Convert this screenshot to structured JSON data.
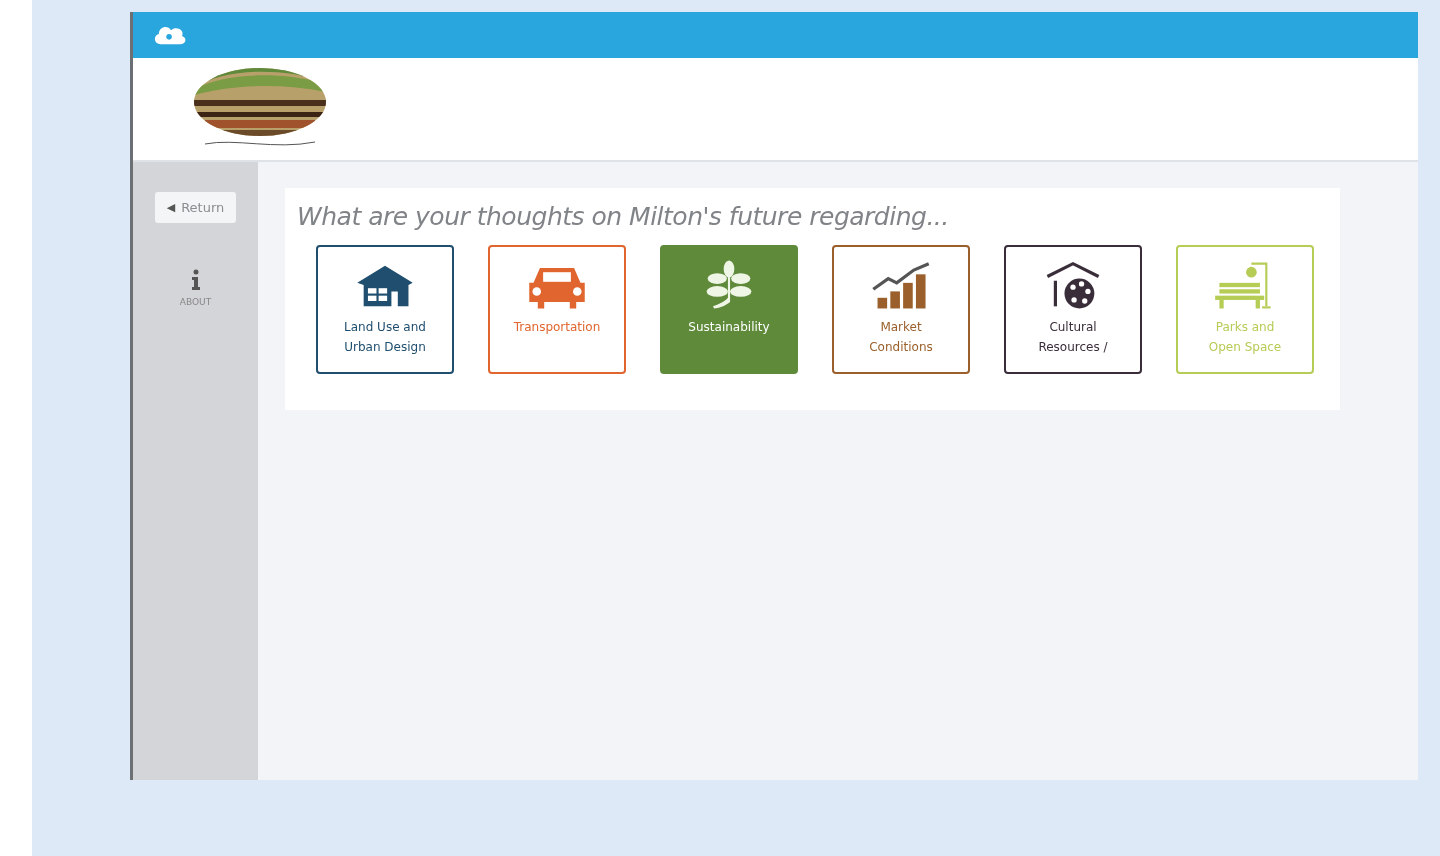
{
  "sidebar": {
    "return_button": {
      "arrow": "◀",
      "label": "Return"
    },
    "about": {
      "label": "ABOUT"
    }
  },
  "question": "What are your thoughts on Milton's future regarding...",
  "topics": [
    {
      "label": "Land Use and Urban Design",
      "kind": "house",
      "color": "#1f4e6e",
      "selected": false
    },
    {
      "label": "Transportation",
      "kind": "car",
      "color": "#e0652e",
      "selected": false
    },
    {
      "label": "Sustainability",
      "kind": "leaf",
      "color": "#5e8a3a",
      "selected": true
    },
    {
      "label": "Market Conditions",
      "kind": "chart",
      "color": "#9a5f2a",
      "selected": false
    },
    {
      "label": "Cultural Resources /",
      "kind": "palette",
      "color": "#3a2d3a",
      "selected": false
    },
    {
      "label": "Parks and Open Space",
      "kind": "bench",
      "color": "#b5cc55",
      "selected": false
    }
  ]
}
